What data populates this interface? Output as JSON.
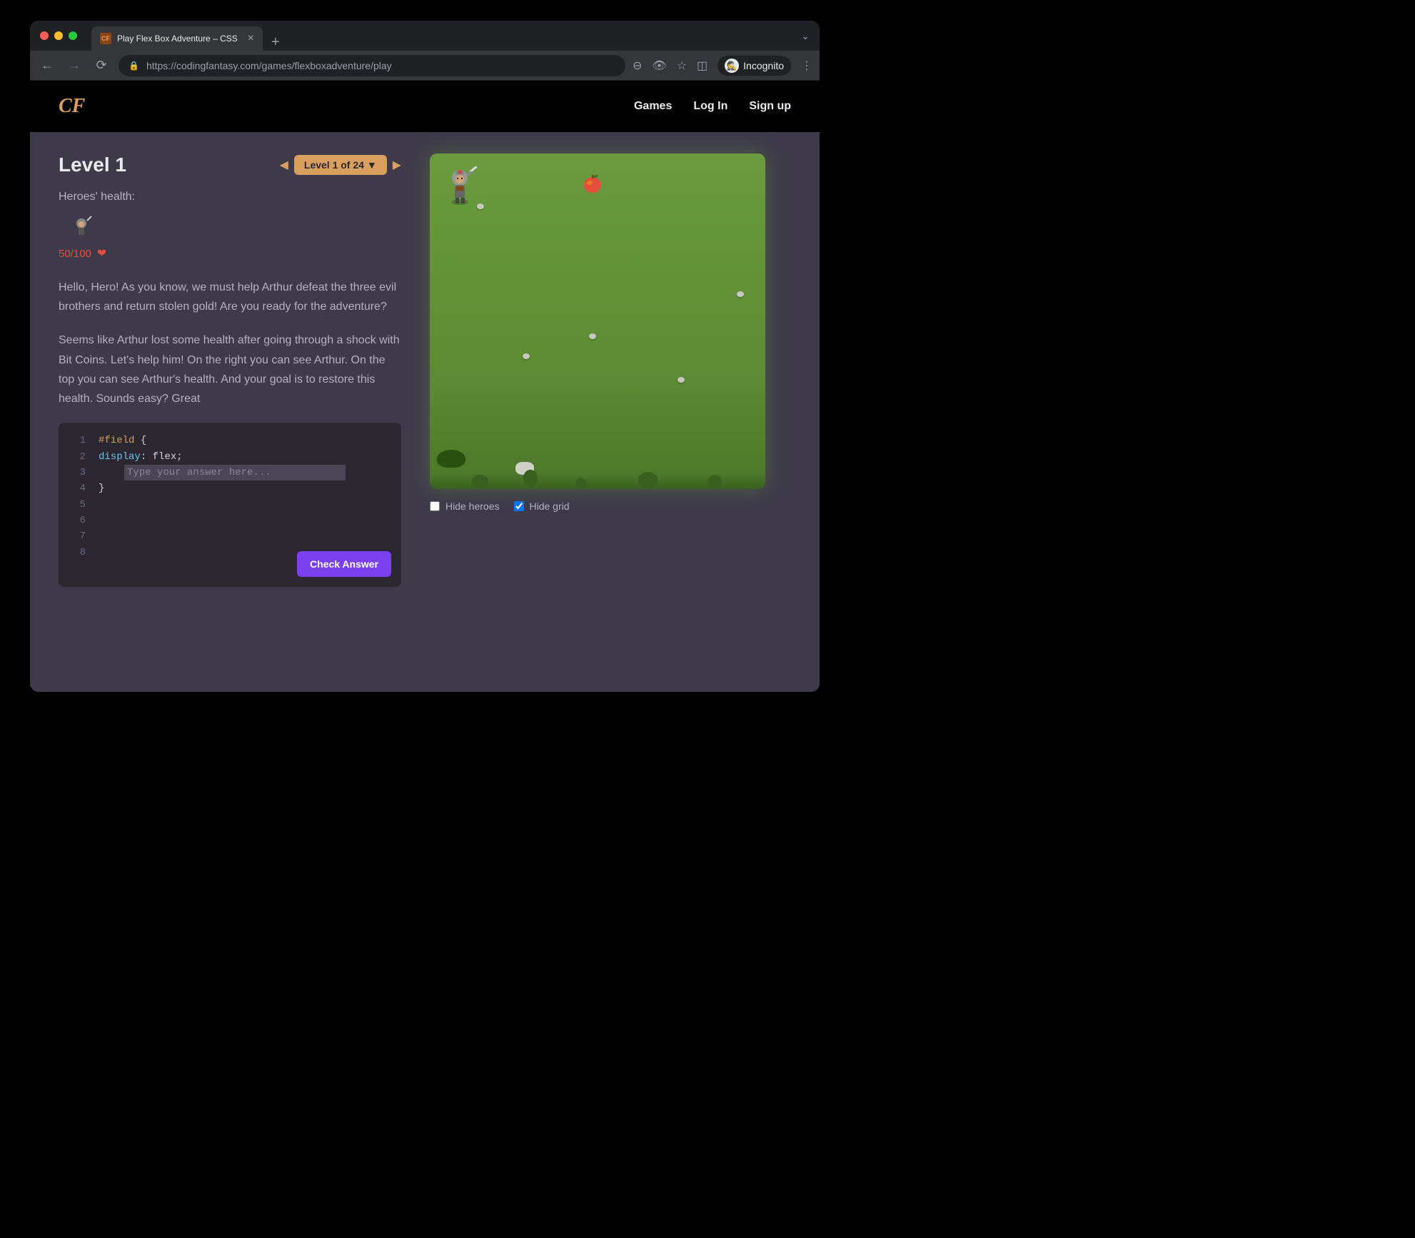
{
  "browser": {
    "tab_title": "Play Flex Box Adventure – CSS",
    "url": "https://codingfantasy.com/games/flexboxadventure/play",
    "incognito_label": "Incognito"
  },
  "header": {
    "logo": "CF",
    "nav": {
      "games": "Games",
      "login": "Log In",
      "signup": "Sign up"
    }
  },
  "level": {
    "title": "Level 1",
    "selector_label": "Level 1 of 24 ▼",
    "health_label": "Heroes' health:",
    "health_value": "50/100",
    "story_p1": "Hello, Hero! As you know, we must help Arthur defeat the three evil brothers and return stolen gold! Are you ready for the adventure?",
    "story_p2": "Seems like Arthur lost some health after going through a shock with Bit Coins. Let's help him! On the right you can see Arthur. On the top you can see Arthur's health. And your goal is to restore this health. Sounds easy? Great"
  },
  "editor": {
    "line1_selector": "#field",
    "line1_brace": " {",
    "line2_indent": "    ",
    "line2_prop": "display",
    "line2_rest": ": flex;",
    "line3_placeholder": "Type your answer here...",
    "line4": "}",
    "check_button": "Check Answer"
  },
  "field_controls": {
    "hide_heroes": "Hide heroes",
    "hide_grid": "Hide grid"
  }
}
